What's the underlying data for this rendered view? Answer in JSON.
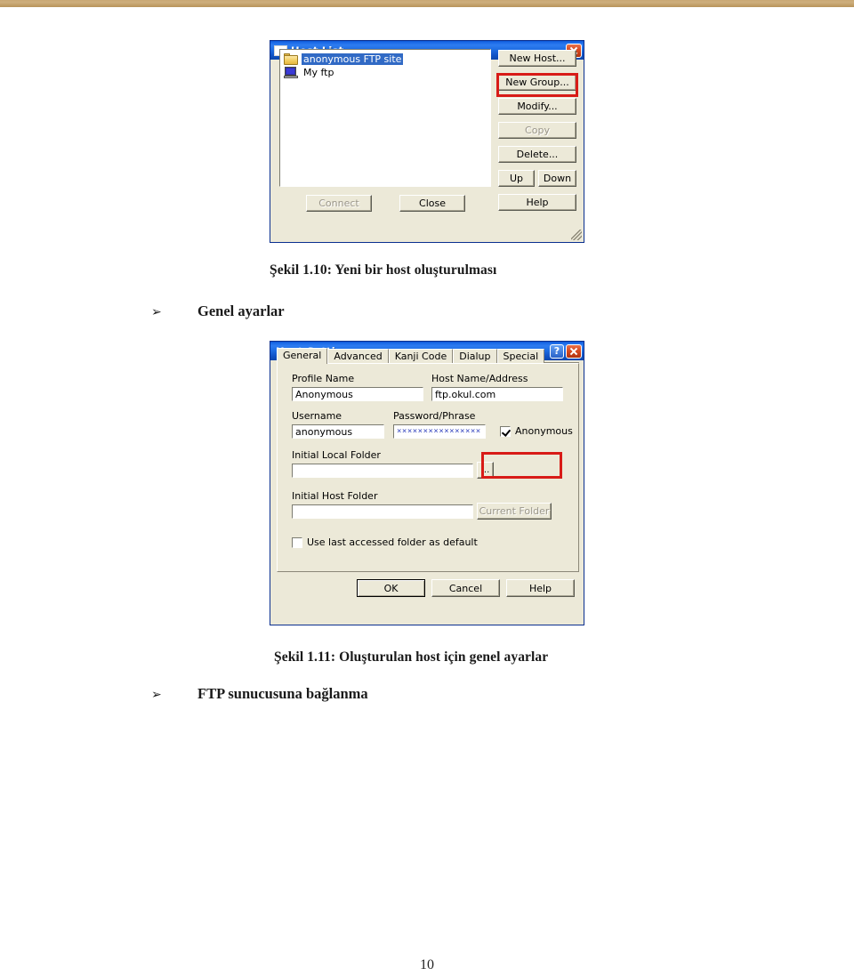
{
  "page": {
    "number": "10",
    "top_rule_color": "#c4a072",
    "background": "#ffffff"
  },
  "figure_1": {
    "caption": "Şekil 1.10: Yeni bir host oluşturulması",
    "bullet_glyph": "➢",
    "bullet_label": "Genel ayarlar",
    "dialog": {
      "title": "Host List",
      "app_icon": "window-icon",
      "close_icon": "close-icon",
      "list": {
        "items": [
          {
            "icon": "folder-icon",
            "label": "anonymous FTP site",
            "selected": true
          },
          {
            "icon": "computer-icon",
            "label": "My ftp",
            "selected": false
          }
        ]
      },
      "side_buttons": [
        {
          "label": "New Host...",
          "disabled": false,
          "highlighted": true
        },
        {
          "label": "New Group...",
          "disabled": false,
          "highlighted": false
        },
        {
          "label": "Modify...",
          "disabled": false,
          "highlighted": false
        },
        {
          "label": "Copy",
          "disabled": true,
          "highlighted": false
        },
        {
          "label": "Delete...",
          "disabled": false,
          "highlighted": false
        }
      ],
      "updown_buttons": [
        {
          "label": "Up",
          "disabled": false
        },
        {
          "label": "Down",
          "disabled": false
        }
      ],
      "help_button": {
        "label": "Help",
        "disabled": false
      },
      "bottom_buttons": [
        {
          "label": "Connect",
          "disabled": true
        },
        {
          "label": "Close",
          "disabled": false
        }
      ],
      "highlight_color": "#d81b17",
      "titlebar_color": "#1b6ae8",
      "selection_color": "#316ac5"
    }
  },
  "figure_2": {
    "caption": "Şekil 1.11: Oluşturulan host için genel ayarlar",
    "bullet_glyph": "➢",
    "bullet_label": "FTP sunucusuna bağlanma",
    "dialog": {
      "title": "Host Setting",
      "help_icon": "question-mark-icon",
      "close_icon": "close-icon",
      "tabs": [
        {
          "label": "General",
          "active": true
        },
        {
          "label": "Advanced",
          "active": false
        },
        {
          "label": "Kanji Code",
          "active": false
        },
        {
          "label": "Dialup",
          "active": false
        },
        {
          "label": "Special",
          "active": false
        }
      ],
      "fields": {
        "profile_name": {
          "label": "Profile Name",
          "value": "Anonymous"
        },
        "host_name": {
          "label": "Host Name/Address",
          "value": "ftp.okul.com"
        },
        "username": {
          "label": "Username",
          "value": "anonymous"
        },
        "password": {
          "label": "Password/Phrase",
          "value": "××××××××××××××××"
        },
        "anonymous_checkbox": {
          "label": "Anonymous",
          "checked": true,
          "highlighted": true
        },
        "initial_local_folder": {
          "label": "Initial Local Folder",
          "value": ""
        },
        "browse_button": {
          "label": "...",
          "disabled": false
        },
        "initial_host_folder": {
          "label": "Initial Host Folder",
          "value": ""
        },
        "current_folder_button": {
          "label": "Current Folder",
          "disabled": true
        },
        "use_last_folder_checkbox": {
          "label": "Use last accessed folder as default",
          "checked": false
        }
      },
      "bottom_buttons": [
        {
          "label": "OK",
          "disabled": false,
          "default": true
        },
        {
          "label": "Cancel",
          "disabled": false,
          "default": false
        },
        {
          "label": "Help",
          "disabled": false,
          "default": false
        }
      ],
      "highlight_color": "#d81b17",
      "titlebar_color": "#1b6ae8"
    }
  }
}
